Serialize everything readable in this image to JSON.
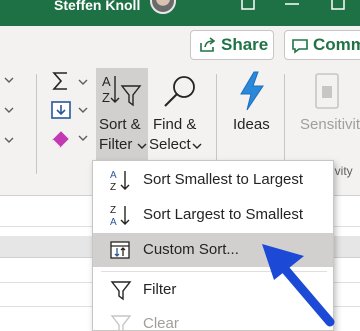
{
  "titlebar": {
    "user_name": "Steffen Knoll"
  },
  "header": {
    "share_label": "Share",
    "comments_label": "Comm"
  },
  "ribbon": {
    "sort_filter": {
      "line1": "Sort &",
      "line2": "Filter"
    },
    "find_select": {
      "line1": "Find &",
      "line2": "Select"
    },
    "ideas": {
      "label": "Ideas"
    },
    "sensitivity": {
      "label": "Sensitivit",
      "group_label": "itivity"
    }
  },
  "menu": {
    "items": [
      {
        "label": "Sort Smallest to Largest",
        "icon": "sort-ascending-icon"
      },
      {
        "label": "Sort Largest to Smallest",
        "icon": "sort-descending-icon"
      },
      {
        "label": "Custom Sort...",
        "icon": "custom-sort-icon"
      },
      {
        "label": "Filter",
        "icon": "filter-icon"
      },
      {
        "label": "Clear",
        "icon": "clear-filter-icon"
      }
    ]
  },
  "colors": {
    "excel_green": "#1e7145",
    "accent_blue": "#1c49d6",
    "hover_gray": "#d2d0ce"
  }
}
